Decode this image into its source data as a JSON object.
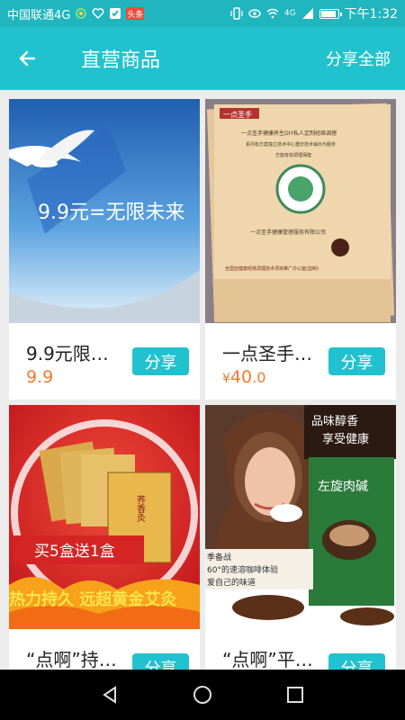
{
  "status_bar": {
    "carrier": "中国联通4G",
    "time": "下午1:32",
    "signal": "4G",
    "app_badge": "头条"
  },
  "header": {
    "title": "直营商品",
    "share_all": "分享全部"
  },
  "products": [
    {
      "name": "9.9元限…",
      "price_text": "9.9",
      "price_prefix": "",
      "price_main": "",
      "price_dec": "",
      "share_label": "分享",
      "banner_text": "9.9元=无限未来"
    },
    {
      "name": "一点圣手…",
      "price_text": "",
      "price_prefix": "¥",
      "price_main": "40",
      "price_dec": ".0",
      "share_label": "分享",
      "brand": "一点圣手",
      "doc_lines": [
        "一点圣手健康养生DIY私人定制经络调理",
        "系列有方案独立技术中心重庆技术输出与服务",
        "方能有效调理保健",
        "一点圣手健康管理服务有限公司",
        "全国亚健康经络调理技术项目推广办公室(监制)"
      ]
    },
    {
      "name": "“点啊”持…",
      "price_text": "",
      "price_prefix": "",
      "price_main": "",
      "price_dec": "",
      "share_label": "分享",
      "promo": "买5盒送1盒",
      "slogan": "热力持久 远超黄金艾灸",
      "label": "荞香灸"
    },
    {
      "name": "“点啊”平…",
      "price_text": "",
      "price_prefix": "",
      "price_main": "",
      "price_dec": "",
      "share_label": "分享",
      "tagline_1": "品味醇香",
      "tagline_2": "享受健康",
      "coffee_lines": [
        "季备战",
        "60°的速溶咖啡体验",
        "爱自己的味道"
      ],
      "box_text": "左旋肉碱"
    }
  ],
  "colors": {
    "status_bar": "#20b5bf",
    "app_bar": "#20c3cd",
    "accent": "#21c2cf",
    "price": "#f07a2d"
  }
}
